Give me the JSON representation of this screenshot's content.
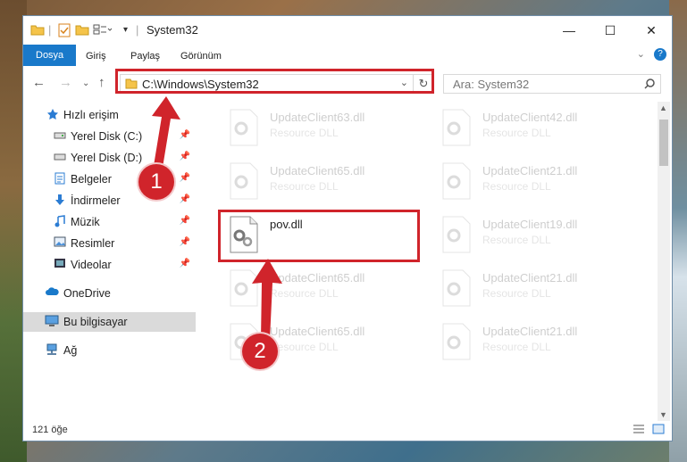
{
  "window": {
    "title": "System32",
    "minimize": "—",
    "maximize": "☐",
    "close": "✕"
  },
  "ribbon": {
    "tabs": [
      {
        "label": "Dosya",
        "active": true
      },
      {
        "label": "Giriş"
      },
      {
        "label": "Paylaş"
      },
      {
        "label": "Görünüm"
      }
    ]
  },
  "nav": {
    "address": "C:\\Windows\\System32",
    "search_placeholder": "Ara: System32"
  },
  "sidebar": {
    "items": [
      {
        "label": "Hızlı erişim",
        "icon": "star-icon"
      },
      {
        "label": "Yerel Disk (C:)",
        "icon": "drive-icon",
        "pinned": true
      },
      {
        "label": "Yerel Disk (D:)",
        "icon": "drive-icon",
        "pinned": true
      },
      {
        "label": "Belgeler",
        "icon": "documents-icon",
        "pinned": true
      },
      {
        "label": "İndirmeler",
        "icon": "download-icon",
        "pinned": true
      },
      {
        "label": "Müzik",
        "icon": "music-icon",
        "pinned": true
      },
      {
        "label": "Resimler",
        "icon": "pictures-icon",
        "pinned": true
      },
      {
        "label": "Videolar",
        "icon": "video-icon",
        "pinned": true
      },
      {
        "label": "OneDrive",
        "icon": "cloud-icon"
      },
      {
        "label": "Bu bilgisayar",
        "icon": "computer-icon",
        "selected": true
      },
      {
        "label": "Ağ",
        "icon": "network-icon"
      }
    ]
  },
  "files": [
    {
      "name": "UpdateClient63.dll",
      "desc": "Resource DLL"
    },
    {
      "name": "UpdateClient42.dll",
      "desc": "Resource DLL"
    },
    {
      "name": "UpdateClient65.dll",
      "desc": "Resource DLL"
    },
    {
      "name": "UpdateClient21.dll",
      "desc": "Resource DLL"
    },
    {
      "name": "pov.dll",
      "desc": ""
    },
    {
      "name": "UpdateClient19.dll",
      "desc": "Resource DLL"
    },
    {
      "name": "UpdateClient65.dll",
      "desc": "Resource DLL"
    },
    {
      "name": "UpdateClient21.dll",
      "desc": "Resource DLL"
    },
    {
      "name": "UpdateClient65.dll",
      "desc": "Resource DLL"
    },
    {
      "name": "UpdateClient21.dll",
      "desc": "Resource DLL"
    }
  ],
  "status": {
    "count": "121 öğe"
  },
  "annotations": {
    "step1": "1",
    "step2": "2"
  },
  "colors": {
    "accent": "#1979ca",
    "highlight": "#d0242b"
  }
}
